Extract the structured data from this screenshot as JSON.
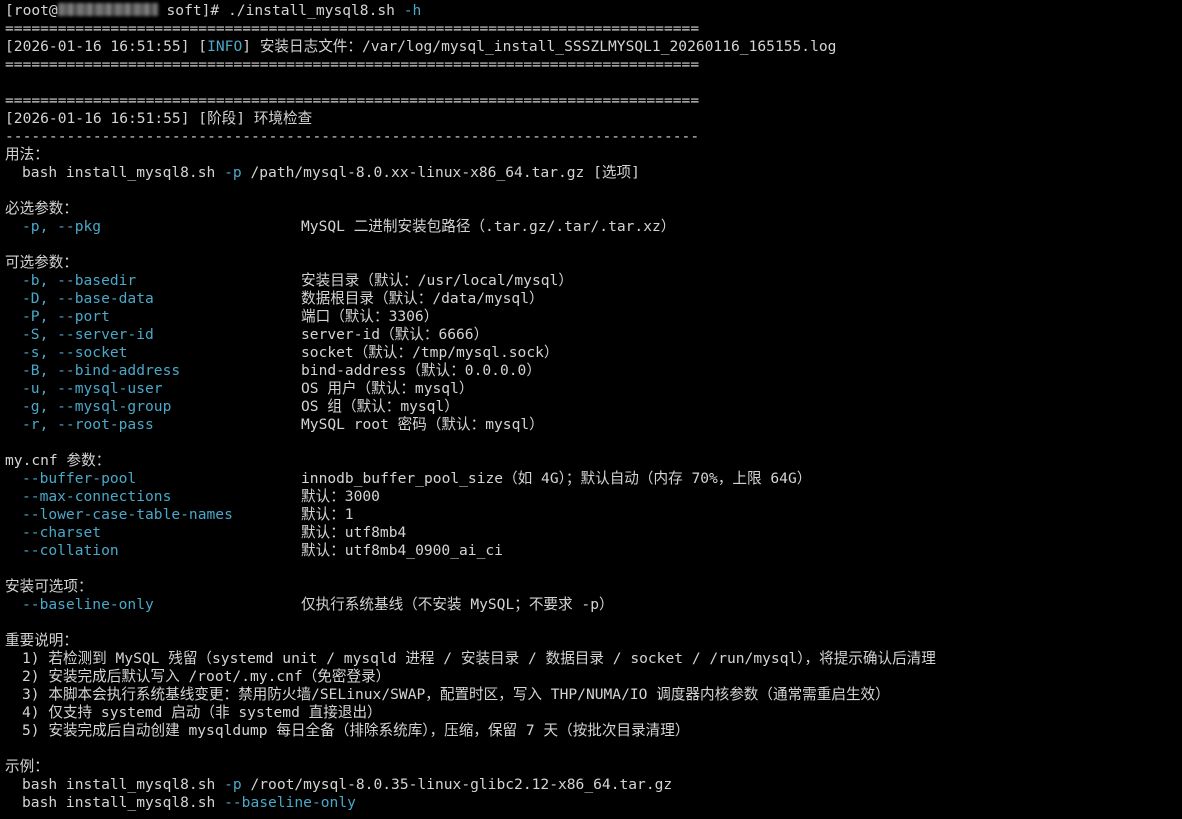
{
  "prompt": {
    "prefix": "[root@",
    "host_hidden": true,
    "suffix": " soft]# ",
    "command": "./install_mysql8.sh",
    "flag": "-h"
  },
  "sep_eq": "===============================================================================",
  "sep_dash": "-------------------------------------------------------------------------------",
  "log_line": {
    "stamp": "[2026-01-16 16:51:55] ",
    "bracket_open": "[",
    "level": "INFO",
    "bracket_close": "]",
    "text": " 安装日志文件：/var/log/mysql_install_SSSZLMYSQL1_20260116_165155.log"
  },
  "stage_line": "[2026-01-16 16:51:55] [阶段] 环境检查",
  "usage": {
    "heading": "用法：",
    "cmd_pre": "bash install_mysql8.sh ",
    "cmd_flag": "-p",
    "cmd_post": " /path/mysql-8.0.xx-linux-x86_64.tar.gz [选项]"
  },
  "required": {
    "heading": "必选参数：",
    "items": [
      {
        "opt": "-p, --pkg",
        "desc": "MySQL 二进制安装包路径（.tar.gz/.tar/.tar.xz）"
      }
    ]
  },
  "optional": {
    "heading": "可选参数：",
    "items": [
      {
        "opt": "-b, --basedir",
        "desc": "安装目录（默认：/usr/local/mysql）"
      },
      {
        "opt": "-D, --base-data",
        "desc": "数据根目录（默认：/data/mysql）"
      },
      {
        "opt": "-P, --port",
        "desc": "端口（默认：3306）"
      },
      {
        "opt": "-S, --server-id",
        "desc": "server-id（默认：6666）"
      },
      {
        "opt": "-s, --socket",
        "desc": "socket（默认：/tmp/mysql.sock）"
      },
      {
        "opt": "-B, --bind-address",
        "desc": "bind-address（默认：0.0.0.0）"
      },
      {
        "opt": "-u, --mysql-user",
        "desc": "OS 用户（默认：mysql）"
      },
      {
        "opt": "-g, --mysql-group",
        "desc": "OS 组（默认：mysql）"
      },
      {
        "opt": "-r, --root-pass",
        "desc": "MySQL root 密码（默认：mysql）"
      }
    ]
  },
  "mycnf": {
    "heading": "my.cnf 参数：",
    "items": [
      {
        "opt": "--buffer-pool",
        "desc": "innodb_buffer_pool_size（如 4G）；默认自动（内存 70%，上限 64G）"
      },
      {
        "opt": "--max-connections",
        "desc": "默认：3000"
      },
      {
        "opt": "--lower-case-table-names",
        "desc": "默认：1"
      },
      {
        "opt": "--charset",
        "desc": "默认：utf8mb4"
      },
      {
        "opt": "--collation",
        "desc": "默认：utf8mb4_0900_ai_ci"
      }
    ]
  },
  "install_opts": {
    "heading": "安装可选项：",
    "items": [
      {
        "opt": "--baseline-only",
        "desc": "仅执行系统基线（不安装 MySQL；不要求 -p）"
      }
    ]
  },
  "notes": {
    "heading": "重要说明：",
    "items": [
      "1) 若检测到 MySQL 残留（systemd unit / mysqld 进程 / 安装目录 / 数据目录 / socket / /run/mysql），将提示确认后清理",
      "2) 安装完成后默认写入 /root/.my.cnf（免密登录）",
      "3) 本脚本会执行系统基线变更：禁用防火墙/SELinux/SWAP，配置时区，写入 THP/NUMA/IO 调度器内核参数（通常需重启生效）",
      "4) 仅支持 systemd 启动（非 systemd 直接退出）",
      "5) 安装完成后自动创建 mysqldump 每日全备（排除系统库），压缩，保留 7 天（按批次目录清理）"
    ]
  },
  "examples": {
    "heading": "示例：",
    "items": [
      {
        "pre": "bash install_mysql8.sh ",
        "flag": "-p",
        "post": " /root/mysql-8.0.35-linux-glibc2.12-x86_64.tar.gz"
      },
      {
        "pre": "bash install_mysql8.sh ",
        "flag": "--baseline-only",
        "post": ""
      }
    ]
  },
  "colors": {
    "background": "#000000",
    "text": "#d4d4d4",
    "accent_cyan": "#4aa8c8"
  }
}
